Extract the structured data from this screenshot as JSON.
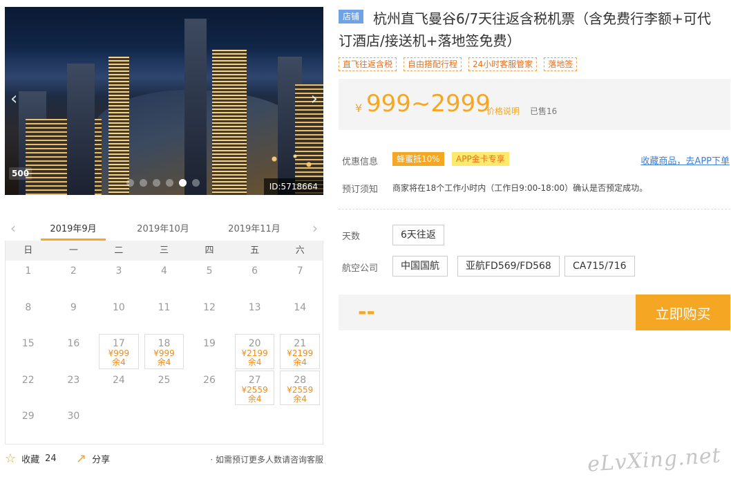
{
  "photo": {
    "id_label": "ID:5718664",
    "logo_text": "500",
    "slide_count": 6,
    "active_slide": 4
  },
  "calendar": {
    "months": [
      "2019年9月",
      "2019年10月",
      "2019年11月"
    ],
    "active_month": 0,
    "weekdays": [
      "日",
      "一",
      "二",
      "三",
      "四",
      "五",
      "六"
    ],
    "start_offset": 0,
    "days_in_month": 30,
    "available": {
      "17": {
        "price": "¥999",
        "stock": "余4"
      },
      "18": {
        "price": "¥999",
        "stock": "余4"
      },
      "20": {
        "price": "¥2199",
        "stock": "余4"
      },
      "21": {
        "price": "¥2199",
        "stock": "余4"
      },
      "27": {
        "price": "¥2559",
        "stock": "余4"
      },
      "28": {
        "price": "¥2559",
        "stock": "余4"
      }
    }
  },
  "footer": {
    "favorite_label": "收藏",
    "favorite_count": "24",
    "share_label": "分享",
    "note": "· 如需预订更多人数请咨询客服"
  },
  "product": {
    "shop_badge": "店铺",
    "title": "杭州直飞曼谷6/7天往返含税机票（含免费行李额+可代订酒店/接送机+落地签免费）",
    "tags": [
      "直飞往返含税",
      "自由搭配行程",
      "24小时客服管家",
      "落地签"
    ],
    "price_symbol": "¥",
    "price_range": "999~2999",
    "price_explain": "价格说明",
    "sold": "已售16",
    "promo_label": "优惠信息",
    "promo_a": "蜂蜜抵10%",
    "promo_b": "APP金卡专享",
    "app_link": "收藏商品，去APP下单",
    "notice_label": "预订须知",
    "notice_text": "商家将在18个工作小时内（工作日9:00-18:00）确认是否预定成功。",
    "days_label": "天数",
    "days_option": "6天往返",
    "airline_label": "航空公司",
    "airlines": [
      "中国国航",
      "亚航FD569/FD568",
      "CA715/716"
    ],
    "selected_price": "--",
    "buy_label": "立即购买"
  },
  "watermark": "eLvXing.net",
  "colors": {
    "accent": "#f5a623",
    "price": "#f08c1b",
    "badge": "#6fa3e6",
    "link": "#3d7fd6"
  }
}
